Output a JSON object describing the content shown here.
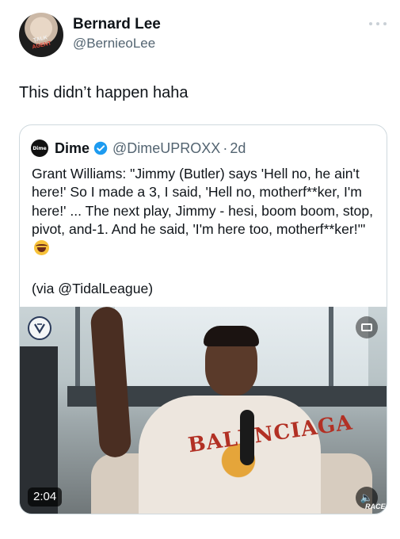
{
  "author": {
    "display_name": "Bernard Lee",
    "handle": "@BernieoLee",
    "avatar_text_top": "TALK",
    "avatar_text_bottom": "AGENT"
  },
  "tweet": {
    "text": "This didn’t happen haha"
  },
  "quote": {
    "logo_text": "Dime",
    "name": "Dime",
    "handle": "@DimeUPROXX",
    "separator": "·",
    "time": "2d",
    "body": "Grant Williams: \"Jimmy (Butler) says 'Hell no, he ain't here!' So I made a 3, I said, 'Hell no, motherf**ker, I'm here!' ... The next play, Jimmy - hesi, boom boom, stop, pivot, and-1. And he said, 'I'm here too, motherf**ker!'\"",
    "via": "(via @TidalLeague)",
    "emoji": "rolling-on-floor-laughing",
    "verified_color": "#1d9bf0"
  },
  "video": {
    "duration": "2:04",
    "shirt_word": "BALENCIAGA",
    "watermark": "RACE"
  },
  "colors": {
    "text": "#0f1419",
    "secondary": "#536471",
    "border": "#cfd9de"
  }
}
